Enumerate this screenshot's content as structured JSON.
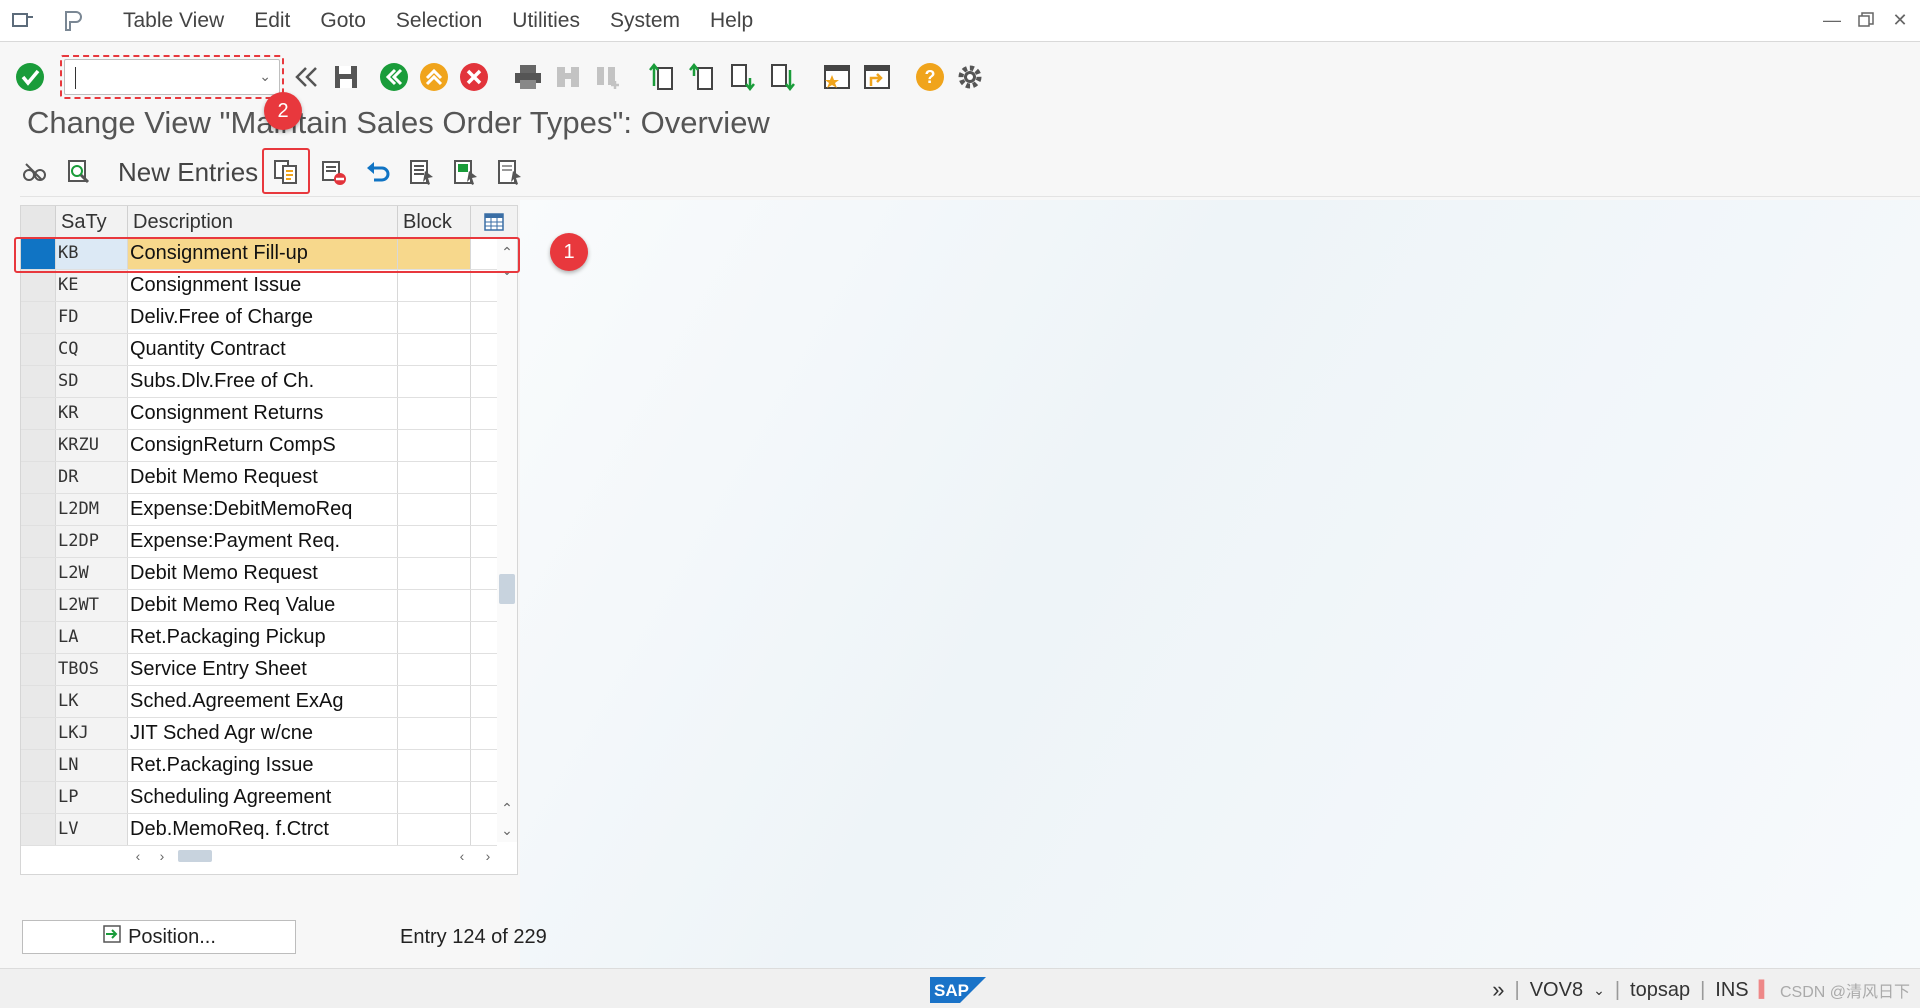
{
  "menu": {
    "items": [
      "Table View",
      "Edit",
      "Goto",
      "Selection",
      "Utilities",
      "System",
      "Help"
    ]
  },
  "toolbar": {
    "command_value": "",
    "command_placeholder": ""
  },
  "title": "Change View \"Maintain Sales Order Types\": Overview",
  "apptoolbar": {
    "new_entries_label": "New Entries"
  },
  "annotations": {
    "badge1": "1",
    "badge2": "2",
    "color": "#e8383d"
  },
  "table": {
    "headers": {
      "saty": "SaTy",
      "description": "Description",
      "block": "Block"
    },
    "rows": [
      {
        "saty": "KB",
        "description": "Consignment Fill-up",
        "block": "",
        "selected": true
      },
      {
        "saty": "KE",
        "description": "Consignment Issue",
        "block": ""
      },
      {
        "saty": "FD",
        "description": "Deliv.Free of Charge",
        "block": ""
      },
      {
        "saty": "CQ",
        "description": "Quantity Contract",
        "block": ""
      },
      {
        "saty": "SD",
        "description": "Subs.Dlv.Free of Ch.",
        "block": ""
      },
      {
        "saty": "KR",
        "description": "Consignment Returns",
        "block": ""
      },
      {
        "saty": "KRZU",
        "description": "ConsignReturn CompS",
        "block": ""
      },
      {
        "saty": "DR",
        "description": "Debit Memo Request",
        "block": ""
      },
      {
        "saty": "L2DM",
        "description": "Expense:DebitMemoReq",
        "block": ""
      },
      {
        "saty": "L2DP",
        "description": "Expense:Payment Req.",
        "block": ""
      },
      {
        "saty": "L2W",
        "description": "Debit Memo Request",
        "block": ""
      },
      {
        "saty": "L2WT",
        "description": "Debit Memo Req Value",
        "block": ""
      },
      {
        "saty": "LA",
        "description": "Ret.Packaging Pickup",
        "block": ""
      },
      {
        "saty": "TBOS",
        "description": "Service Entry Sheet",
        "block": ""
      },
      {
        "saty": "LK",
        "description": "Sched.Agreement ExAg",
        "block": ""
      },
      {
        "saty": "LKJ",
        "description": "JIT Sched Agr w/cne",
        "block": ""
      },
      {
        "saty": "LN",
        "description": "Ret.Packaging Issue",
        "block": ""
      },
      {
        "saty": "LP",
        "description": "Scheduling Agreement",
        "block": ""
      },
      {
        "saty": "LV",
        "description": "Deb.MemoReq. f.Ctrct",
        "block": ""
      }
    ]
  },
  "footer": {
    "position_label": "Position...",
    "entry_info": "Entry 124 of 229"
  },
  "statusbar": {
    "logo": "SAP",
    "transaction": "VOV8",
    "system": "topsap",
    "mode": "INS",
    "watermark": "CSDN @清风日下"
  },
  "colors": {
    "selected_row": "#f7d88c",
    "selection_marker": "#1074c4",
    "ok_green": "#1a9c3a",
    "cancel_red": "#e2343b",
    "nav_orange": "#f0a41c"
  }
}
